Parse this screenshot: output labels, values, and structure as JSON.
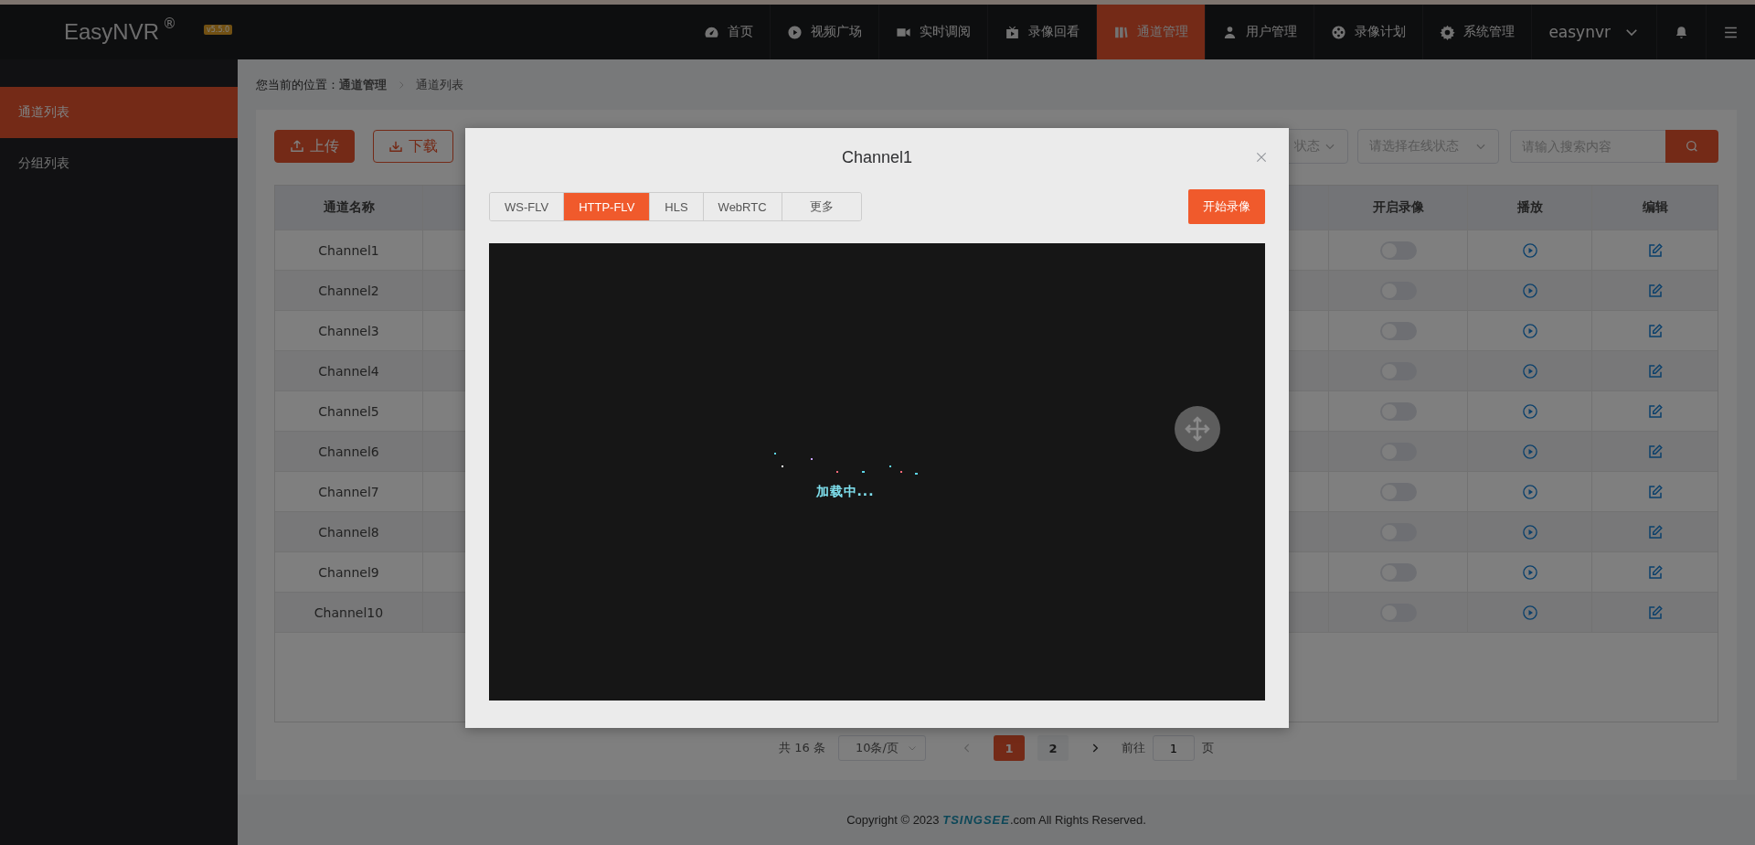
{
  "header": {
    "logo": "EasyNVR",
    "logo_mark": "®",
    "version": "v5.5.0",
    "user": "easynvr",
    "nav": [
      {
        "label": "首页",
        "selected": false
      },
      {
        "label": "视频广场",
        "selected": false
      },
      {
        "label": "实时调阅",
        "selected": false
      },
      {
        "label": "录像回看",
        "selected": false
      },
      {
        "label": "通道管理",
        "selected": true
      },
      {
        "label": "用户管理",
        "selected": false
      },
      {
        "label": "录像计划",
        "selected": false
      },
      {
        "label": "系统管理",
        "selected": false
      }
    ]
  },
  "sidebar": {
    "items": [
      {
        "label": "通道列表",
        "selected": true
      },
      {
        "label": "分组列表",
        "selected": false
      }
    ]
  },
  "breadcrumb": {
    "prefix": "您当前的位置：",
    "items": [
      "通道管理",
      "通道列表"
    ]
  },
  "toolbar": {
    "buttons": [
      {
        "label": "上传",
        "kind": "upload"
      },
      {
        "label": "下载",
        "kind": "download"
      }
    ],
    "filters": [
      {
        "placeholder": "状态"
      },
      {
        "placeholder": "请选择在线状态"
      }
    ],
    "search": {
      "placeholder": "请输入搜索内容"
    }
  },
  "table": {
    "columns": [
      "通道名称",
      "开启录像",
      "播放",
      "编辑"
    ],
    "rows": [
      {
        "name": "Channel1",
        "recording": false
      },
      {
        "name": "Channel2",
        "recording": false
      },
      {
        "name": "Channel3",
        "recording": false
      },
      {
        "name": "Channel4",
        "recording": false
      },
      {
        "name": "Channel5",
        "recording": false
      },
      {
        "name": "Channel6",
        "recording": false
      },
      {
        "name": "Channel7",
        "recording": false
      },
      {
        "name": "Channel8",
        "recording": false
      },
      {
        "name": "Channel9",
        "recording": false
      },
      {
        "name": "Channel10",
        "recording": false
      }
    ]
  },
  "pagination": {
    "total": "共 16 条",
    "page_size": "10条/页",
    "pages": [
      {
        "label": "1",
        "selected": true
      },
      {
        "label": "2",
        "selected": false
      }
    ],
    "goto_label": "前往",
    "goto_value": "1",
    "goto_suffix": "页"
  },
  "footer": {
    "prefix": "Copyright © 2023 ",
    "brand": "TSINGSEE",
    "suffix": ".com All Rights Reserved."
  },
  "dialog": {
    "title": "Channel1",
    "tabs": [
      {
        "label": "WS-FLV",
        "selected": false
      },
      {
        "label": "HTTP-FLV",
        "selected": true
      },
      {
        "label": "HLS",
        "selected": false
      },
      {
        "label": "WebRTC",
        "selected": false
      },
      {
        "label": "更多",
        "selected": false
      }
    ],
    "record_button": "开始录像",
    "loading": "加载中..."
  }
}
